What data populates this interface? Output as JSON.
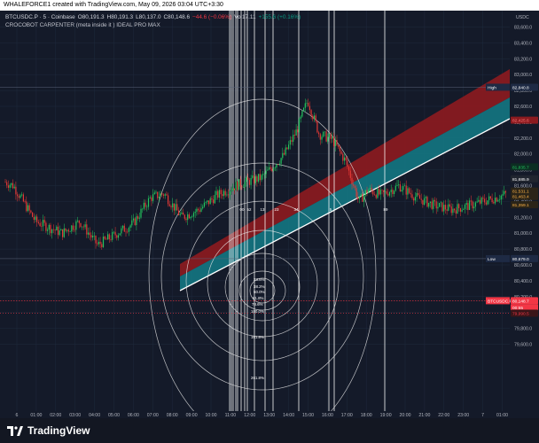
{
  "header": {
    "text": "WHALEFORCE1 created with TradingView.com, May 09, 2026 03:04 UTC+3:30"
  },
  "legend": {
    "symbol": "BTCUSDC.P · 5 · Coinbase",
    "open": "O80,191.3",
    "high": "H80,191.3",
    "low": "L80,137.0",
    "close": "C80,148.6",
    "change": "−44.6 (−0.06%)",
    "volume": "Vol17.11",
    "volume_change": "+155.6 (+0.16%)",
    "indicator": "CROCOBOT CARPENTER (meta inside it ) IDEAL PRO MAX"
  },
  "axis": {
    "currency": "USDC",
    "y_ticks": [
      "83,600.0",
      "83,400.0",
      "83,200.0",
      "83,000.0",
      "82,800.0",
      "82,600.0",
      "82,400.0",
      "82,200.0",
      "82,000.0",
      "81,800.0",
      "81,600.0",
      "81,400.0",
      "81,200.0",
      "81,000.0",
      "80,800.0",
      "80,600.0",
      "80,400.0",
      "80,200.0",
      "80,000.0",
      "79,800.0",
      "79,600.0"
    ],
    "x_ticks": [
      "6",
      "01:00",
      "02:00",
      "03:00",
      "04:00",
      "05:00",
      "06:00",
      "07:00",
      "08:00",
      "09:00",
      "10:00",
      "11:00",
      "12:00",
      "13:00",
      "14:00",
      "15:00",
      "16:00",
      "17:00",
      "18:00",
      "19:00",
      "20:00",
      "21:00",
      "22:00",
      "23:00",
      "7",
      "01:00"
    ]
  },
  "price_labels": {
    "high_tag": "High",
    "high_value": "82,840.8",
    "low_tag": "Low",
    "low_value": "80,679.0",
    "last_symbol": "BTCUSDC.P",
    "last_value": "80,148.7",
    "countdown": "00:55",
    "red_level_top": "82,425.6",
    "green_level": "81,835.7",
    "white_level": "81,685.9",
    "orange_1": "81,531.1",
    "orange_2": "81,463.4",
    "orange_3": "81,359.1",
    "red_level_bottom": "79,990.5"
  },
  "annotations": {
    "time_markers": [
      "00",
      "52",
      "13",
      "23",
      "34",
      "5",
      "89"
    ],
    "fib_levels": [
      "23.6%",
      "38.2%",
      "50.0%",
      "61.8%",
      "78.6%",
      "100.0%",
      "161.8%",
      "261.8%"
    ]
  },
  "footer": {
    "brand": "TradingView"
  },
  "colors": {
    "background": "#141a29",
    "bull_candle": "#22c55e",
    "bear_candle": "#e53935",
    "channel_red": "#8b1a1f",
    "channel_teal": "#137480",
    "grid": "#253046"
  }
}
